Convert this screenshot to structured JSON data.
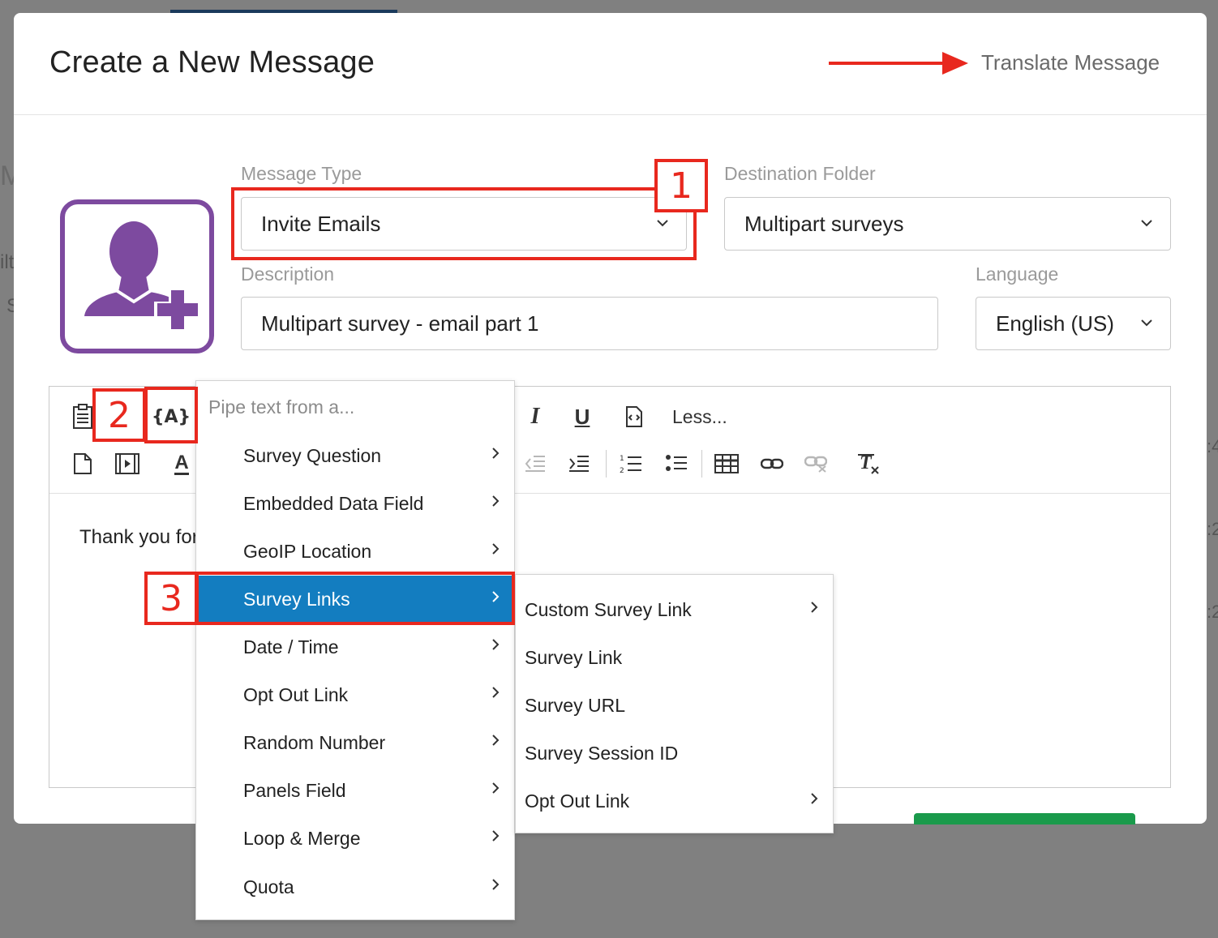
{
  "modal": {
    "title": "Create a New Message",
    "translate_label": "Translate Message"
  },
  "form": {
    "message_type": {
      "label": "Message Type",
      "value": "Invite Emails"
    },
    "destination_folder": {
      "label": "Destination Folder",
      "value": "Multipart surveys"
    },
    "description": {
      "label": "Description",
      "value": "Multipart survey - email part 1"
    },
    "language": {
      "label": "Language",
      "value": "English (US)"
    }
  },
  "editor": {
    "less_label": "Less...",
    "body_text": "Thank you for"
  },
  "pipe_menu": {
    "heading": "Pipe text from a...",
    "items": [
      {
        "label": "Survey Question"
      },
      {
        "label": "Embedded Data Field"
      },
      {
        "label": "GeoIP Location"
      },
      {
        "label": "Survey Links"
      },
      {
        "label": "Date / Time"
      },
      {
        "label": "Opt Out Link"
      },
      {
        "label": "Random Number"
      },
      {
        "label": "Panels Field"
      },
      {
        "label": "Loop & Merge"
      },
      {
        "label": "Quota"
      }
    ],
    "active_item": "Survey Links"
  },
  "survey_links_submenu": {
    "items": [
      {
        "label": "Custom Survey Link",
        "has_submenu": true
      },
      {
        "label": "Survey Link",
        "has_submenu": false
      },
      {
        "label": "Survey URL",
        "has_submenu": false
      },
      {
        "label": "Survey Session ID",
        "has_submenu": false
      },
      {
        "label": "Opt Out Link",
        "has_submenu": true
      }
    ]
  },
  "annotations": {
    "step1": "1",
    "step2": "2",
    "step3": "3",
    "color": "#e8281e"
  },
  "colors": {
    "accent_purple": "#7d4a9f",
    "menu_active": "#137dc0",
    "primary_green": "#1a9a4b"
  },
  "background_fragments": {
    "frag_a": "Mu",
    "frag_b": "ilt",
    "frag_c": "S",
    "frag_d": ":4",
    "frag_e": ":2",
    "frag_f": ":2"
  }
}
